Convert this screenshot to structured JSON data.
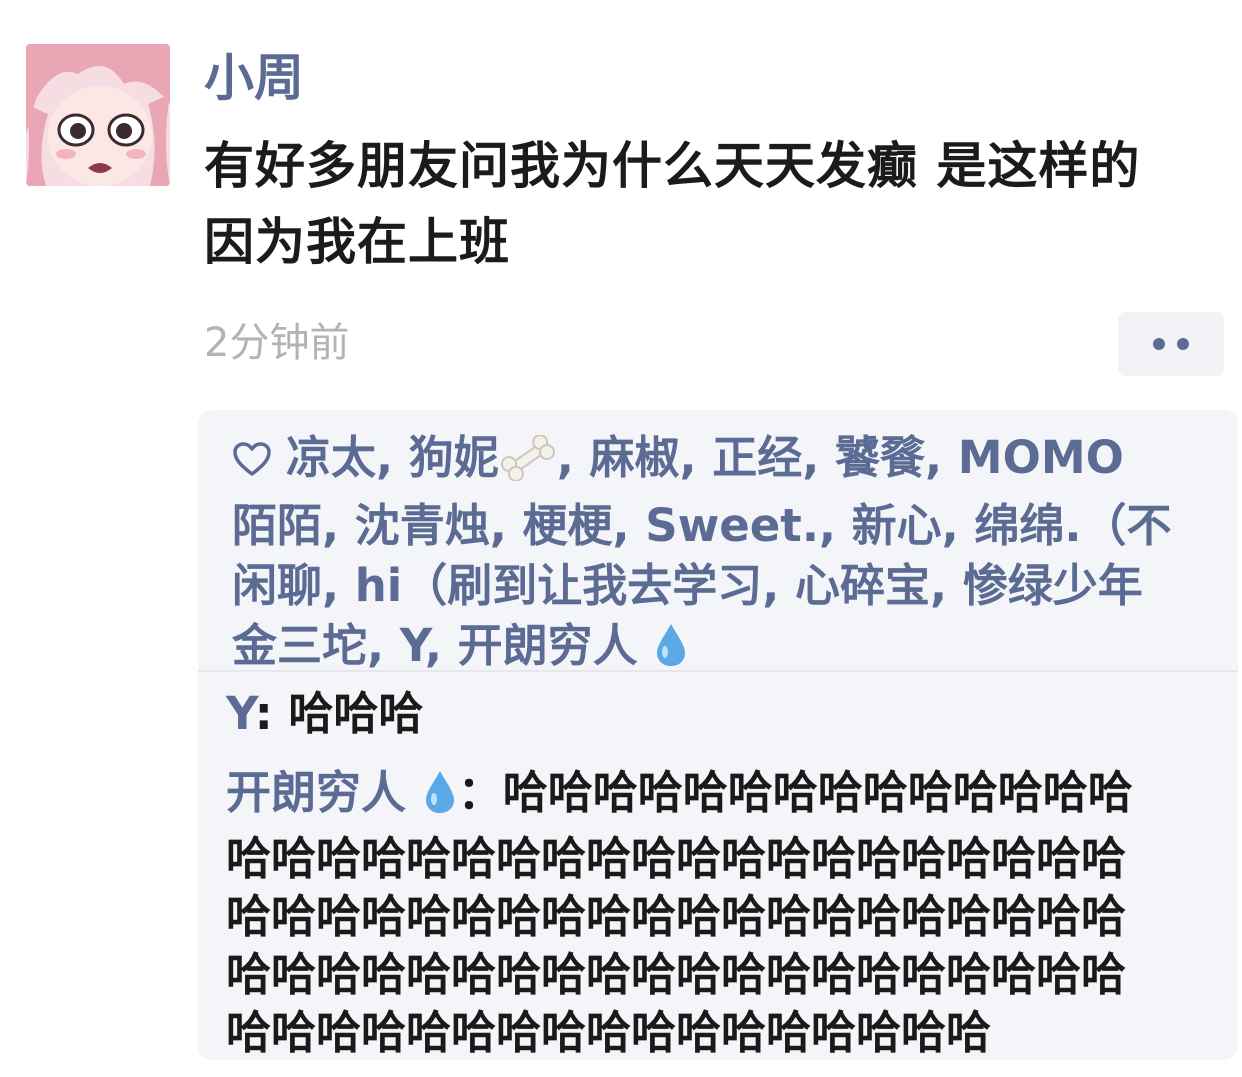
{
  "post": {
    "author": "小周",
    "text_lines": [
      "有好多朋友问我为什么天天发癫 是这样的",
      " 因为我在上班"
    ],
    "timestamp": "2分钟前"
  },
  "likes": {
    "lines": [
      "凉太, 狗妮",
      ", 麻椒, 正经, 饕餮, MOMO",
      "陌陌, 沈青烛, 梗梗, Sweet., 新心, 绵绵.（不",
      "闲聊, hi（刷到让我去学习, 心碎宝, 惨绿少年",
      "金三坨, Y, 开朗穷人"
    ]
  },
  "comments": [
    {
      "name": "Y",
      "separator": ": ",
      "text": "哈哈哈"
    },
    {
      "name": "开朗穷人",
      "separator": "：",
      "lines": [
        "哈哈哈哈哈哈哈哈哈哈哈哈哈哈",
        "哈哈哈哈哈哈哈哈哈哈哈哈哈哈哈哈哈哈哈哈",
        "哈哈哈哈哈哈哈哈哈哈哈哈哈哈哈哈哈哈哈哈",
        "哈哈哈哈哈哈哈哈哈哈哈哈哈哈哈哈哈哈哈哈",
        "哈哈哈哈哈哈哈哈哈哈哈哈哈哈哈哈哈"
      ]
    }
  ],
  "icons": {
    "like": "heart-icon",
    "more": "more-dots-icon",
    "bone": "bone-emoji",
    "drop": "water-drop-emoji"
  },
  "colors": {
    "name_blue": "#5b6b94",
    "timestamp_gray": "#b3b3b3",
    "panel_bg": "#f4f5f8",
    "text_dark": "#1b1b1b"
  }
}
